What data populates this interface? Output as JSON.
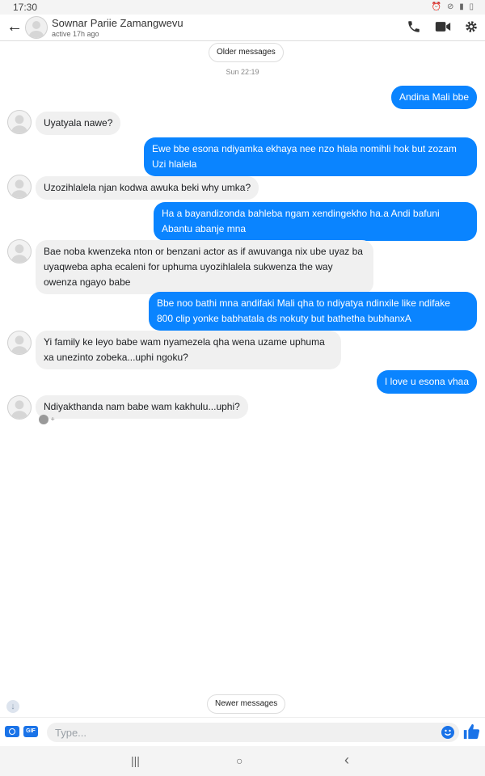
{
  "status_bar": {
    "time": "17:30",
    "icons": "⏰ ⊘ ▮ ▯"
  },
  "header": {
    "back_icon": "arrow-left",
    "contact_name": "Sownar Pariie Zamangwevu",
    "contact_status": "active 17h ago",
    "actions": [
      "phone-icon",
      "video-icon",
      "gear-icon"
    ]
  },
  "chat": {
    "older_label": "Older messages",
    "date_label": "Sun 22:19",
    "newer_label": "Newer messages",
    "reaction": "+",
    "messages": [
      {
        "dir": "out",
        "text": "Andina Mali bbe"
      },
      {
        "dir": "in",
        "text": "Uyatyala nawe?"
      },
      {
        "dir": "out",
        "text": "Ewe bbe esona ndiyamka ekhaya nee nzo hlala nomihli hok but zozam Uzi hlalela"
      },
      {
        "dir": "in",
        "text": "Uzozihlalela njan kodwa awuka beki why umka?"
      },
      {
        "dir": "out",
        "text": "Ha a bayandizonda bahleba ngam xendingekho ha.a Andi bafuni Abantu abanje mna"
      },
      {
        "dir": "in",
        "text": "Bae noba kwenzeka nton or benzani actor as if awuvanga nix ube uyaz ba uyaqweba apha ecaleni for uphuma uyozihlalela sukwenza the way owenza ngayo babe"
      },
      {
        "dir": "out",
        "text": "Bbe noo bathi mna andifaki Mali qha to ndiyatya ndinxile like ndifake 800 clip yonke babhatala ds nokuty but bathetha bubhanxA"
      },
      {
        "dir": "in",
        "text": "Yi family ke leyo babe wam nyamezela qha wena uzame uphuma xa unezinto zobeka...uphi ngoku?"
      },
      {
        "dir": "out",
        "text": "I love u esona vhaa"
      },
      {
        "dir": "in",
        "text": "Ndiyakthanda nam babe wam kakhulu...uphi?"
      }
    ]
  },
  "composer": {
    "placeholder": "Type...",
    "gif_label": "GIF"
  },
  "nav": {
    "recents": "|||",
    "home": "○",
    "back": "‹"
  },
  "colors": {
    "outgoing_bubble": "#0a84ff",
    "incoming_bubble": "#f0f0f0",
    "accent": "#1a73e8"
  }
}
